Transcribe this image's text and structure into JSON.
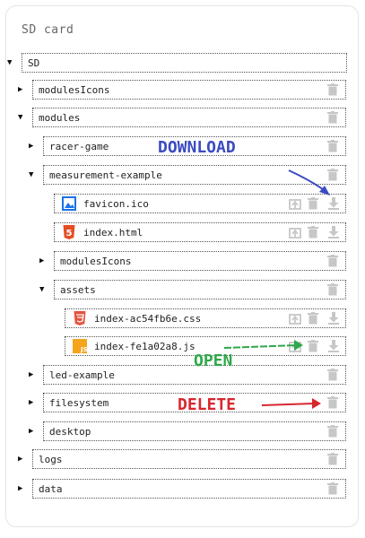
{
  "panel": {
    "title": "SD card"
  },
  "tree": {
    "root": "SD",
    "modulesIcons_top": "modulesIcons",
    "modules": "modules",
    "racer_game": "racer-game",
    "measurement_example": "measurement-example",
    "favicon": "favicon.ico",
    "index_html": "index.html",
    "modulesIcons_inner": "modulesIcons",
    "assets": "assets",
    "index_css": "index-ac54fb6e.css",
    "index_js": "index-fe1a02a8.js",
    "led_example": "led-example",
    "filesystem": "filesystem",
    "desktop": "desktop",
    "logs": "logs",
    "data": "data"
  },
  "annotations": {
    "download": "DOWNLOAD",
    "open": "OPEN",
    "delete": "DELETE"
  },
  "icons": {
    "expanded": "triangle-down-icon",
    "collapsed": "triangle-right-icon",
    "delete": "trash-icon",
    "open": "open-external-icon",
    "download": "download-icon"
  },
  "colors": {
    "download_annotation": "#3b4bc0",
    "open_annotation": "#2fa84a",
    "delete_annotation": "#d8262e",
    "icon_gray": "#c7c7c7",
    "html5": "#e54d26",
    "css3": "#e5533c",
    "js": "#f4a51c",
    "image": "#1a73e8"
  }
}
